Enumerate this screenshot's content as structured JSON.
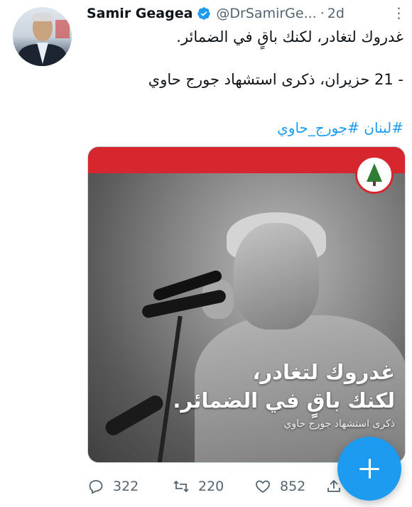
{
  "tweet": {
    "author": {
      "name": "Samir Geagea",
      "handle": "@DrSamirGe...",
      "separator": "·",
      "time": "2d",
      "more_label": "⋮"
    },
    "text_line1": "غدروك لتغادر، لكنك باقٍ في الضمائر.",
    "text_line2": "- 21 حزيران، ذكرى استشهاد جورج حاوي",
    "hashtags": "#لبنان #جورج_حاوي"
  },
  "media": {
    "overlay_line1": "غدروك لتغادر،",
    "overlay_line2": "لكنك باقٍ في الضمائر.",
    "overlay_line3": "ذكرى استشهاد جورج حاوي",
    "bar_color": "#d8262f"
  },
  "actions": {
    "replies": "322",
    "retweets": "220",
    "likes": "852"
  },
  "colors": {
    "accent": "#1d9bf0",
    "text": "#0f1419",
    "secondary": "#536471"
  }
}
